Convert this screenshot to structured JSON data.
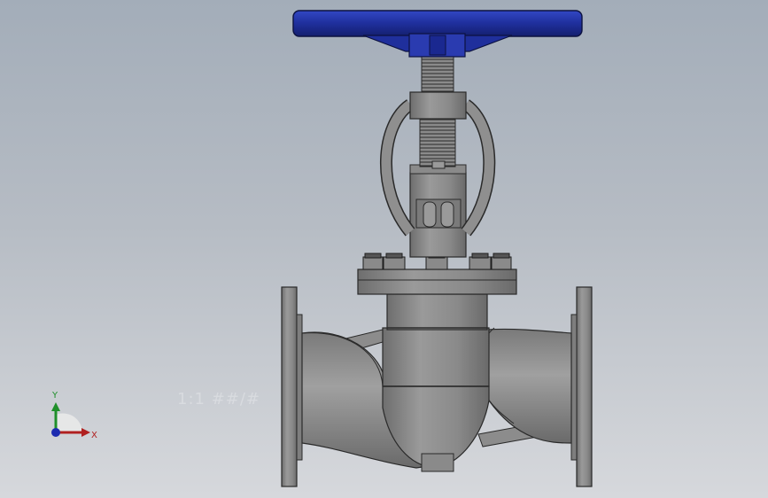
{
  "viewport": {
    "background_top": "#a3adb9",
    "background_bottom": "#d6d8dc",
    "watermark_text": "1:1 ##/#"
  },
  "model": {
    "handwheel_color": "#1f2f9c",
    "metal_color": "#8f8f8f",
    "edge_color": "#2a2a2a"
  },
  "triad": {
    "x_label": "X",
    "y_label": "Y",
    "x_color": "#b02020",
    "y_color": "#1f8f2a",
    "z_color": "#1c2bb0"
  }
}
